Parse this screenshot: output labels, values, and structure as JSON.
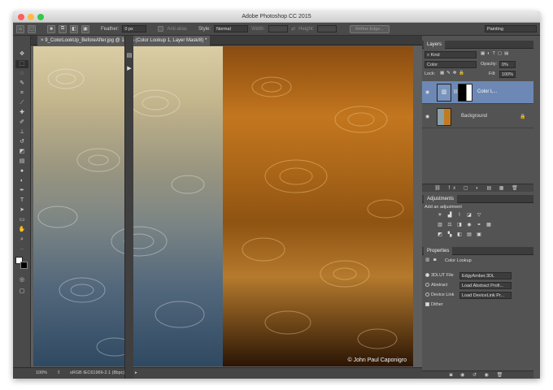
{
  "window": {
    "title": "Adobe Photoshop CC 2015"
  },
  "options": {
    "feather_label": "Feather:",
    "feather_value": "0 px",
    "antialias_label": "Anti-alias",
    "style_label": "Style:",
    "style_value": "Normal",
    "width_label": "Width:",
    "height_label": "Height:",
    "refine_edge": "Refine Edge...",
    "workspace": "Painting"
  },
  "document": {
    "tab_title": "9_ColorLookUp_BeforeAfter.jpg @ 100% (Color Lookup 1, Layer Mask/8) *",
    "copyright": "© John Paul Caponigro"
  },
  "status": {
    "zoom": "100%",
    "profile": "sRGB IEC61966-2.1 (8bpc)"
  },
  "layers": {
    "tab": "Layers",
    "kind": "Kind",
    "blend_mode": "Color",
    "opacity_label": "Opacity:",
    "opacity_value": "0%",
    "lock_label": "Lock:",
    "fill_label": "Fill:",
    "fill_value": "100%",
    "items": [
      {
        "name": "Color L..."
      },
      {
        "name": "Background"
      }
    ]
  },
  "adjustments": {
    "tab": "Adjustments",
    "heading": "Add an adjustment"
  },
  "properties": {
    "tab": "Properties",
    "title": "Color Lookup",
    "options": [
      {
        "label": "3DLUT File",
        "value": "EdgyAmber.3DL"
      },
      {
        "label": "Abstract",
        "value": "Load Abstract Profi..."
      },
      {
        "label": "Device Link",
        "value": "Load DeviceLink Pr..."
      }
    ],
    "dither_label": "Dither"
  },
  "colors": {
    "accent": "#6d88b4"
  }
}
